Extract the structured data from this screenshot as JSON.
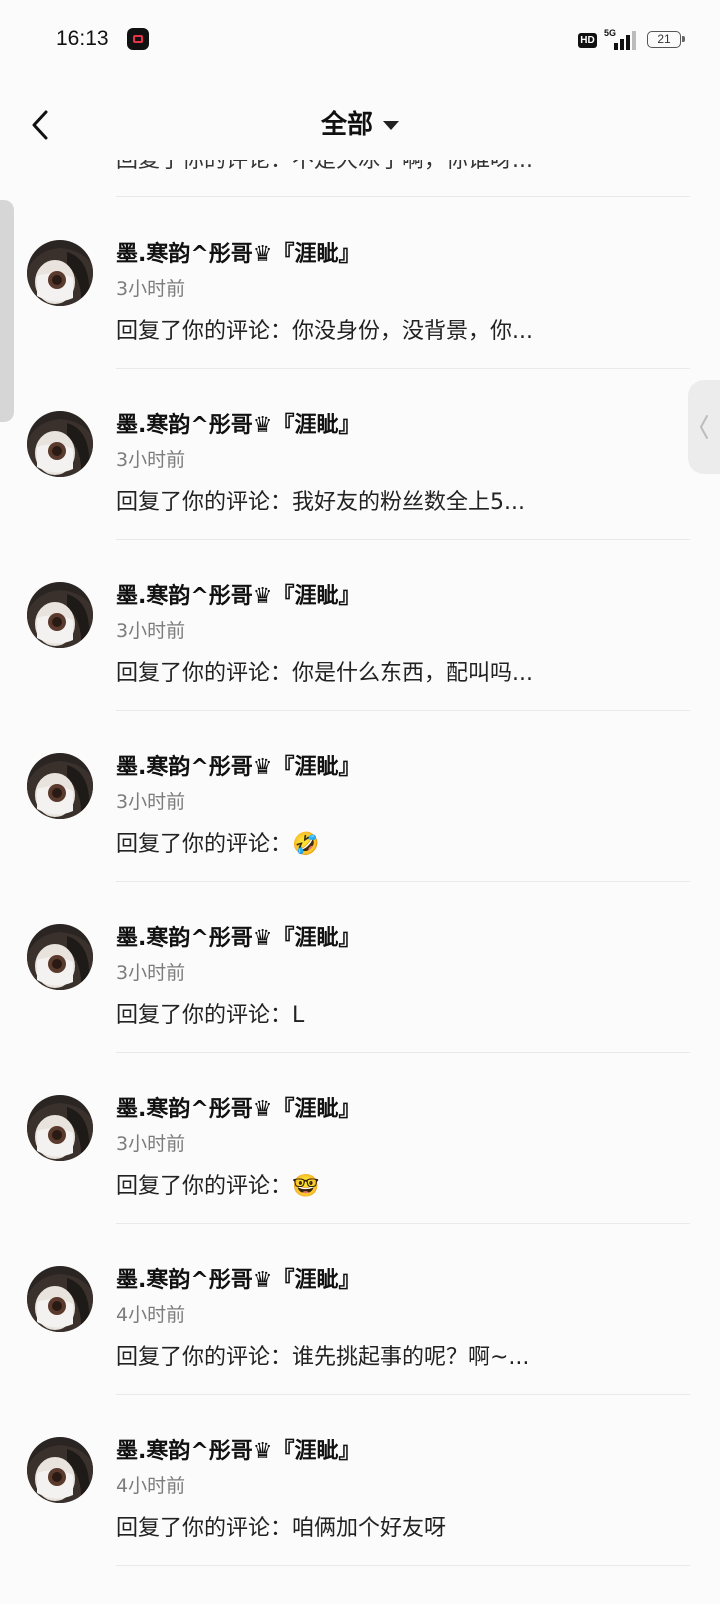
{
  "status_bar": {
    "time": "16:13",
    "hd_label": "HD",
    "network_label": "5G",
    "battery_level": "21",
    "signal_bars_lit": 3
  },
  "header": {
    "title": "全部",
    "back_icon": "chevron-left-icon",
    "dropdown_icon": "caret-down-icon"
  },
  "partial_top_item": {
    "comment": "回复了你的评论：不是大冰了啊，你谁呀..."
  },
  "items": [
    {
      "name": "墨.寒韵^彤哥♛『涯眦』",
      "time": "3小时前",
      "comment": "回复了你的评论：你没身份，没背景，你..."
    },
    {
      "name": "墨.寒韵^彤哥♛『涯眦』",
      "time": "3小时前",
      "comment": "回复了你的评论：我好友的粉丝数全上5..."
    },
    {
      "name": "墨.寒韵^彤哥♛『涯眦』",
      "time": "3小时前",
      "comment": "回复了你的评论：你是什么东西，配叫吗..."
    },
    {
      "name": "墨.寒韵^彤哥♛『涯眦』",
      "time": "3小时前",
      "comment": "回复了你的评论：🤣"
    },
    {
      "name": "墨.寒韵^彤哥♛『涯眦』",
      "time": "3小时前",
      "comment": "回复了你的评论：L"
    },
    {
      "name": "墨.寒韵^彤哥♛『涯眦』",
      "time": "3小时前",
      "comment": "回复了你的评论：🤓"
    },
    {
      "name": "墨.寒韵^彤哥♛『涯眦』",
      "time": "4小时前",
      "comment": "回复了你的评论：谁先挑起事的呢？啊~..."
    },
    {
      "name": "墨.寒韵^彤哥♛『涯眦』",
      "time": "4小时前",
      "comment": "回复了你的评论：咱俩加个好友呀"
    }
  ],
  "colors": {
    "background": "#fbfbfb",
    "text_primary": "#111111",
    "text_secondary": "#7c7c7c",
    "divider": "#e9e9e9"
  }
}
